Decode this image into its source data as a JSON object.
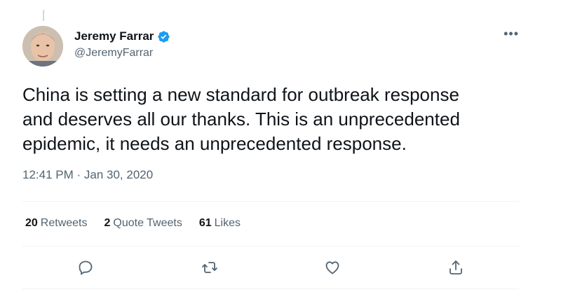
{
  "author": {
    "name": "Jeremy Farrar",
    "handle": "@JeremyFarrar",
    "verified": true
  },
  "tweet": {
    "text": "China is setting a new standard for outbreak response\nand deserves all our thanks.  This is an unprecedented\nepidemic, it needs an unprecedented response.",
    "timestamp": "12:41 PM · Jan 30, 2020"
  },
  "stats": {
    "retweets_count": "20",
    "retweets_label": "Retweets",
    "quotes_count": "2",
    "quotes_label": "Quote Tweets",
    "likes_count": "61",
    "likes_label": "Likes"
  },
  "actions": {
    "reply_icon": "reply-icon",
    "retweet_icon": "retweet-icon",
    "like_icon": "heart-icon",
    "share_icon": "share-icon"
  },
  "colors": {
    "verified": "#1d9bf0",
    "secondary_text": "#536471",
    "divider": "#eff3f4"
  }
}
